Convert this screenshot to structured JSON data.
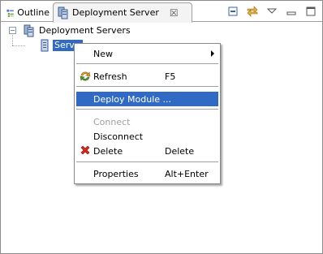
{
  "tabs": [
    {
      "label": "Outline",
      "icon": "outline-icon"
    },
    {
      "label": "Deployment Server",
      "icon": "deployment-server-icon",
      "close_icon": "close-icon"
    }
  ],
  "toolbar": {
    "actions": [
      "collapse-all-icon",
      "link-with-editor-icon",
      "view-menu-icon",
      "minimize-icon",
      "maximize-icon"
    ]
  },
  "tree": {
    "root": {
      "label": "Deployment Servers",
      "expanded": true,
      "icon": "server-group-icon"
    },
    "child": {
      "label": "Server",
      "selected": true,
      "icon": "server-icon"
    }
  },
  "context_menu": {
    "items": [
      {
        "label": "New",
        "accel": "",
        "submenu": true,
        "enabled": true,
        "icon": ""
      },
      {
        "label": "Refresh",
        "accel": "F5",
        "enabled": true,
        "icon": "refresh-icon"
      },
      {
        "label": "Deploy Module ...",
        "accel": "",
        "enabled": true,
        "highlighted": true,
        "icon": ""
      },
      {
        "label": "Connect",
        "accel": "",
        "enabled": false,
        "icon": ""
      },
      {
        "label": "Disconnect",
        "accel": "",
        "enabled": true,
        "icon": ""
      },
      {
        "label": "Delete",
        "accel": "Delete",
        "enabled": true,
        "icon": "delete-icon"
      },
      {
        "label": "Properties",
        "accel": "Alt+Enter",
        "enabled": true,
        "icon": ""
      }
    ]
  },
  "colors": {
    "selection": "#316ac5",
    "disabled_text": "#a0a0a0",
    "delete_red": "#d6281c"
  }
}
